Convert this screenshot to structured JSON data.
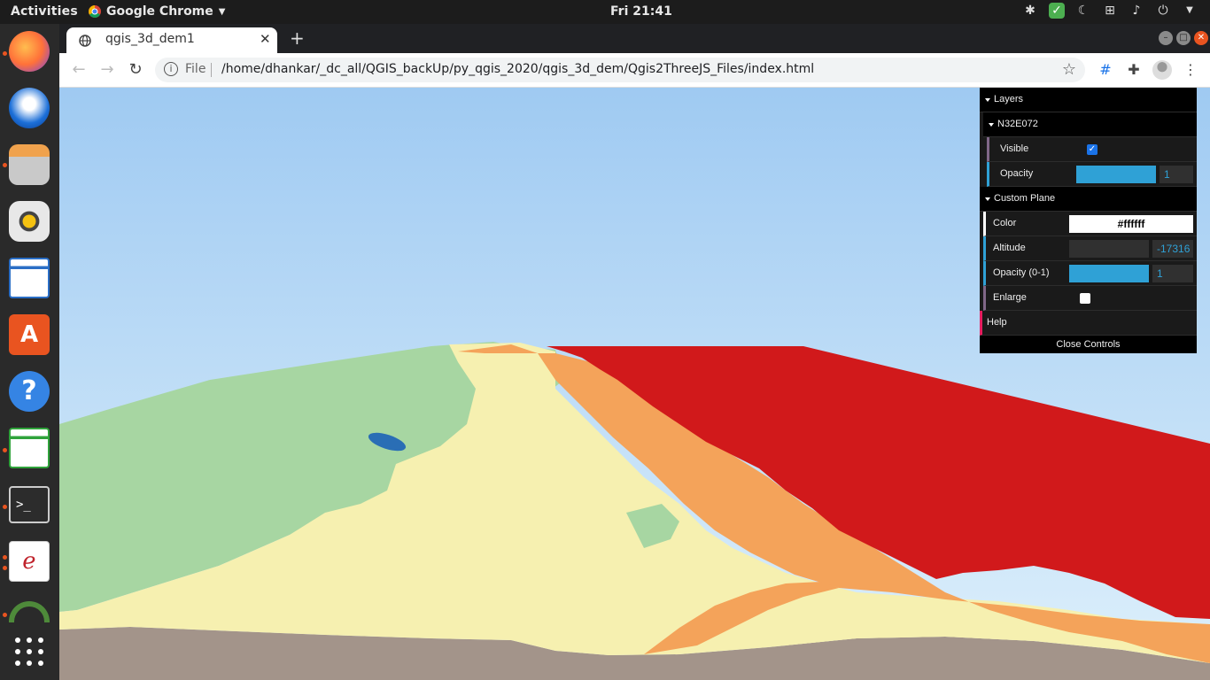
{
  "topbar": {
    "activities": "Activities",
    "app_name": "Google Chrome",
    "clock": "Fri 21:41"
  },
  "dock": {
    "apps": [
      "firefox-icon",
      "thunderbird-icon",
      "files-icon",
      "rhythmbox-icon",
      "writer-icon",
      "software-icon",
      "help-icon",
      "calc-icon",
      "terminal-icon",
      "document-viewer-icon",
      "system-monitor-icon"
    ]
  },
  "browser": {
    "tab_title": "qgis_3d_dem1",
    "tab_close": "✕",
    "new_tab": "+",
    "scheme_label": "File",
    "url": "/home/dhankar/_dc_all/QGIS_backUp/py_qgis_2020/qgis_3d_dem/Qgis2ThreeJS_Files/index.html"
  },
  "gui": {
    "layers_folder": "Layers",
    "layer_name": "N32E072",
    "visible_label": "Visible",
    "visible_checked": true,
    "opacity_label": "Opacity",
    "opacity_value": "1",
    "opacity_fraction": 1,
    "custom_plane_folder": "Custom Plane",
    "color_label": "Color",
    "color_value": "#ffffff",
    "altitude_label": "Altitude",
    "altitude_value": "-17316",
    "altitude_fraction": 0,
    "plane_opacity_label": "Opacity (0-1)",
    "plane_opacity_value": "1",
    "plane_opacity_fraction": 1,
    "enlarge_label": "Enlarge",
    "enlarge_checked": false,
    "help_label": "Help",
    "close_controls": "Close Controls"
  },
  "colors": {
    "accent": "#2fa1d6",
    "ubuntu_orange": "#e95420",
    "terrain_red": "#d1191b",
    "terrain_orange": "#f4a35a",
    "terrain_yellow": "#f6f0b0",
    "terrain_green": "#a7d6a2",
    "water_blue": "#2a6eb5",
    "ground": "#a3948a"
  }
}
